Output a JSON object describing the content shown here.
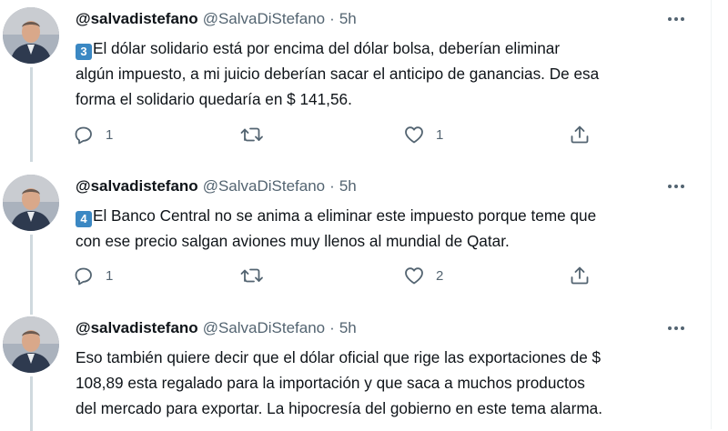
{
  "tweets": [
    {
      "name": "@salvadistefano",
      "handle": "@SalvaDiStefano",
      "separator": "·",
      "time": "5h",
      "keycap": "3",
      "lines": [
        "El dólar solidario está por encima del dólar bolsa, deberían eliminar",
        "algún impuesto, a mi juicio deberían sacar el anticipo de ganancias. De esa",
        "forma el solidario quedaría en $ 141,56."
      ],
      "reply_count": "1",
      "retweet_count": "",
      "like_count": "1"
    },
    {
      "name": "@salvadistefano",
      "handle": "@SalvaDiStefano",
      "separator": "·",
      "time": "5h",
      "keycap": "4",
      "lines": [
        "El Banco Central no se anima a eliminar este impuesto porque teme que",
        "con ese precio salgan aviones muy llenos al mundial de Qatar."
      ],
      "reply_count": "1",
      "retweet_count": "",
      "like_count": "2"
    },
    {
      "name": "@salvadistefano",
      "handle": "@SalvaDiStefano",
      "separator": "·",
      "time": "5h",
      "lines": [
        "Eso también quiere decir que el dólar oficial que rige las exportaciones de $",
        "108,89 esta regalado para la importación y que saca a muchos productos",
        "del mercado para exportar. La hipocresía del gobierno en este tema alarma."
      ]
    }
  ],
  "icons": {
    "reply": "reply-icon",
    "retweet": "retweet-icon",
    "like": "like-icon",
    "share": "share-icon",
    "more": "more-icon"
  },
  "colors": {
    "text": "#0f1419",
    "secondary": "#536471",
    "thread_line": "#cfd9de",
    "keycap": "#3b88c3"
  }
}
